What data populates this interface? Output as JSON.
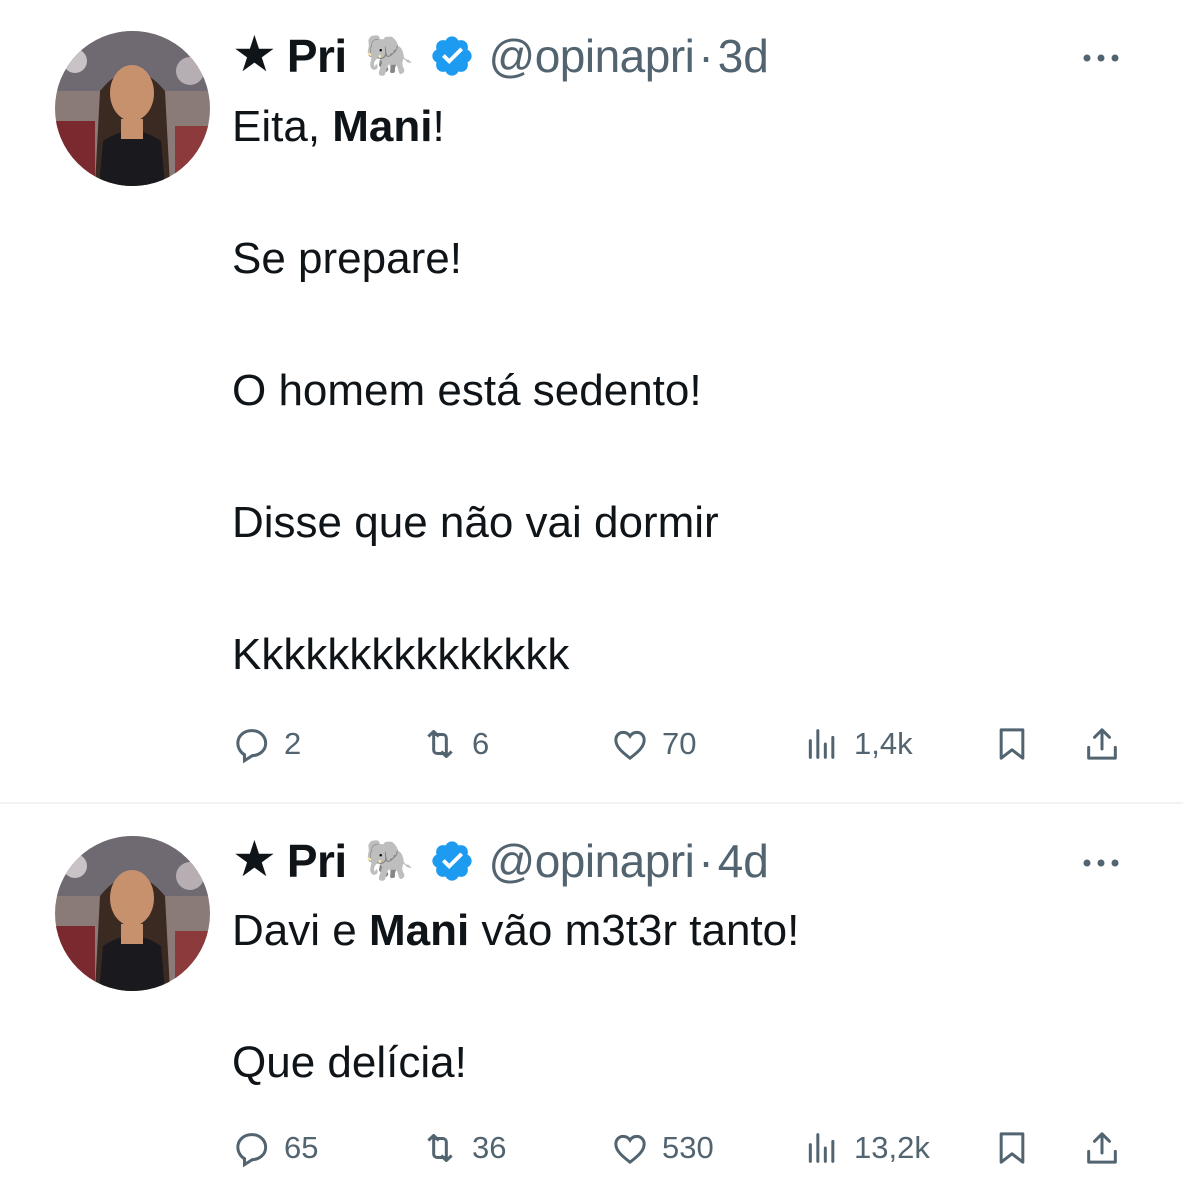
{
  "tweets": [
    {
      "display_name": "Pri",
      "prefix_symbol": "★",
      "emoji": "🐘",
      "handle": "@opinapri",
      "separator": "·",
      "time": "3d",
      "lines": [
        {
          "before": "Eita, ",
          "bold": "Mani",
          "after": "!"
        },
        {
          "text": "Se prepare!"
        },
        {
          "text": "O homem está sedento!"
        },
        {
          "text": "Disse que não vai dormir"
        },
        {
          "text": "Kkkkkkkkkkkkkkk"
        }
      ],
      "stats": {
        "replies": "2",
        "retweets": "6",
        "likes": "70",
        "views": "1,4k"
      }
    },
    {
      "display_name": "Pri",
      "prefix_symbol": "★",
      "emoji": "🐘",
      "handle": "@opinapri",
      "separator": "·",
      "time": "4d",
      "lines": [
        {
          "before": "Davi e ",
          "bold": "Mani",
          "after": " vão m3t3r tanto!"
        },
        {
          "text": "Que delícia!"
        }
      ],
      "stats": {
        "replies": "65",
        "retweets": "36",
        "likes": "530",
        "views": "13,2k"
      }
    }
  ],
  "colors": {
    "text": "#0f1419",
    "secondary": "#536471",
    "verified": "#1d9bf0",
    "divider": "#eff3f4"
  },
  "icons": [
    "reply-icon",
    "retweet-icon",
    "like-icon",
    "views-icon",
    "bookmark-icon",
    "share-icon",
    "more-icon",
    "verified-icon"
  ]
}
